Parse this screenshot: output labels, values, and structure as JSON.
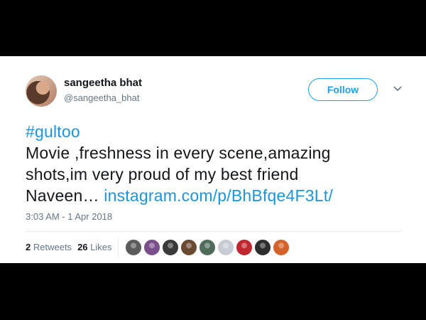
{
  "tweet": {
    "user": {
      "display_name": "sangeetha bhat",
      "handle": "@sangeetha_bhat"
    },
    "follow_label": "Follow",
    "text": {
      "hashtag": "#gultoo",
      "line1": "Movie ,freshness in every scene,amazing",
      "line2": "shots,im very proud of my best friend",
      "line3_prefix": "Naveen… ",
      "link": "instagram.com/p/BhBfqe4F3Lt/"
    },
    "timestamp": "3:03 AM - 1 Apr 2018",
    "stats": {
      "retweets_count": "2",
      "retweets_label": "Retweets",
      "likes_count": "26",
      "likes_label": "Likes"
    },
    "liker_avatars": [
      {
        "color": "#5b5b5b"
      },
      {
        "color": "#7a4f8c"
      },
      {
        "color": "#3a3a3a"
      },
      {
        "color": "#6b4a32"
      },
      {
        "color": "#4f6b5a"
      },
      {
        "color": "#c7cdd2"
      },
      {
        "color": "#c0262d"
      },
      {
        "color": "#2e2e2e"
      },
      {
        "color": "#d4622a"
      }
    ],
    "colors": {
      "accent": "#1da1f2",
      "link": "#1b95e0",
      "text": "#14171a",
      "secondary": "#657786"
    }
  }
}
